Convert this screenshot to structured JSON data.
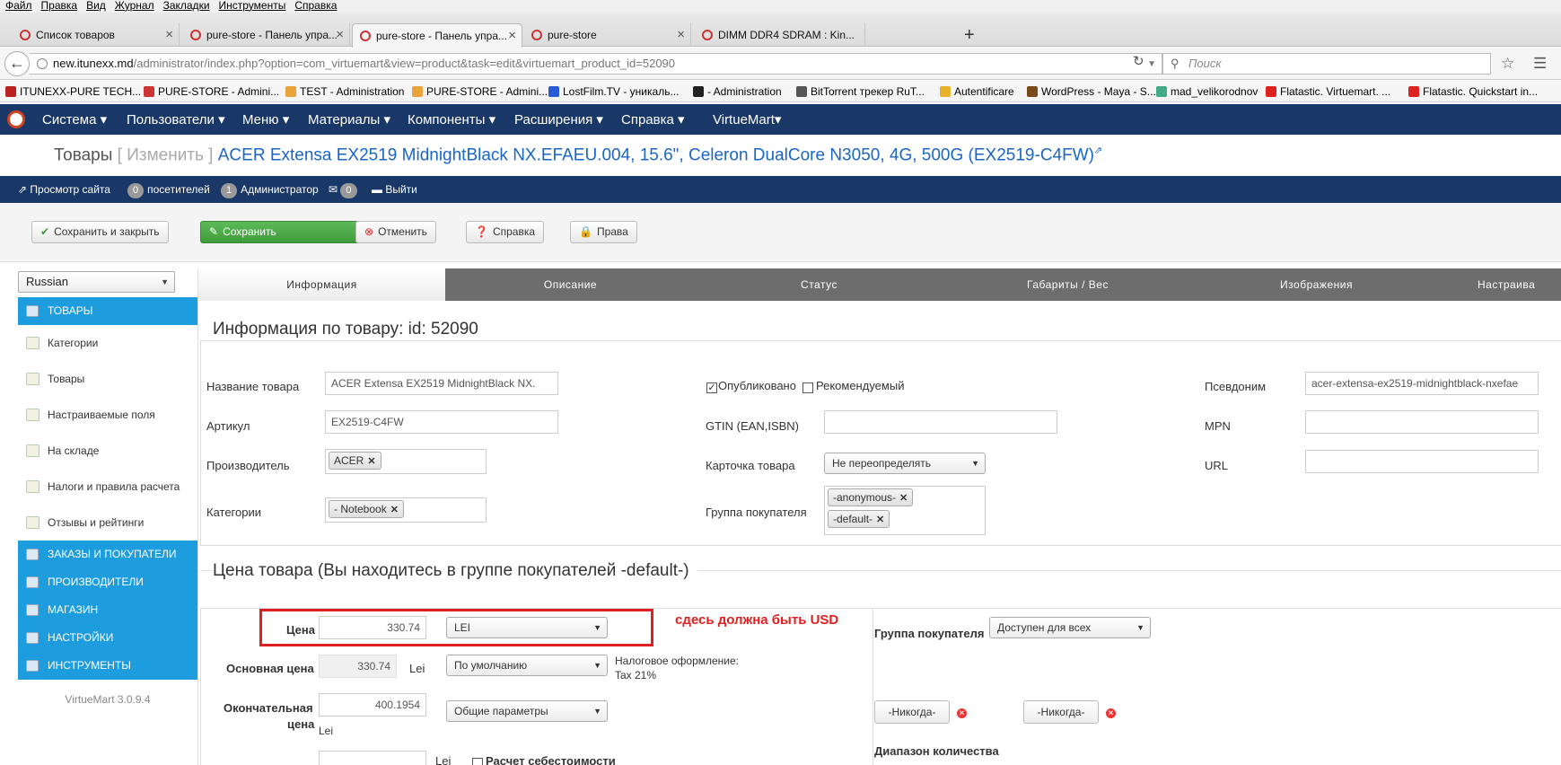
{
  "browser": {
    "menu": [
      "Файл",
      "Правка",
      "Вид",
      "Журнал",
      "Закладки",
      "Инструменты",
      "Справка"
    ],
    "tabs": [
      {
        "label": "Список товаров"
      },
      {
        "label": "pure-store - Панель упра..."
      },
      {
        "label": "pure-store - Панель упра..."
      },
      {
        "label": "pure-store"
      },
      {
        "label": "DIMM DDR4 SDRAM : Kin..."
      }
    ],
    "new_tab": "+",
    "url_host": "new.itunexx.md",
    "url_path": "/administrator/index.php?option=com_virtuemart&view=product&task=edit&virtuemart_product_id=52090",
    "search_placeholder": "Поиск",
    "bookmarks": [
      {
        "label": "ITUNEXX-PURE TECH...",
        "color": "#b22"
      },
      {
        "label": "PURE-STORE - Admini...",
        "color": "#c33"
      },
      {
        "label": "TEST - Administration",
        "color": "#e8a33a"
      },
      {
        "label": "PURE-STORE - Admini...",
        "color": "#e8a33a"
      },
      {
        "label": "LostFilm.TV - уникаль...",
        "color": "#2a5bd7"
      },
      {
        "label": "- Administration",
        "color": "#222"
      },
      {
        "label": "BitTorrent трекер RuT...",
        "color": "#555"
      },
      {
        "label": "Autentificare",
        "color": "#e8b22a"
      },
      {
        "label": "WordPress - Maya - S...",
        "color": "#7a4a1a"
      },
      {
        "label": "mad_velikorodnov",
        "color": "#4a8"
      },
      {
        "label": "Flatastic. Virtuemart. ...",
        "color": "#d22"
      },
      {
        "label": "Flatastic. Quickstart in...",
        "color": "#d22"
      }
    ]
  },
  "admin_menu": [
    "Система ▾",
    "Пользователи ▾",
    "Меню ▾",
    "Материалы ▾",
    "Компоненты ▾",
    "Расширения ▾",
    "Справка ▾",
    "VirtueMart▾"
  ],
  "title": {
    "section": "Товары",
    "mode": "[ Изменить ]",
    "product": "ACER Extensa EX2519 MidnightBlack NX.EFAEU.004, 15.6\", Celeron DualCore N3050, 4G, 500G (EX2519-C4FW)"
  },
  "status": {
    "view_site": "Просмотр сайта",
    "visitors_count": "0",
    "visitors_label": "посетителей",
    "admins_count": "1",
    "admins_label": "Администратор",
    "messages_count": "0",
    "logout": "Выйти"
  },
  "toolbar": {
    "save_close": "Сохранить и закрыть",
    "save": "Сохранить",
    "cancel": "Отменить",
    "help": "Справка",
    "rights": "Права"
  },
  "sidebar": {
    "language": "Russian",
    "header_products": "ТОВАРЫ",
    "items": [
      "Категории",
      "Товары",
      "Настраиваемые поля",
      "На складе",
      "Налоги и правила расчета",
      "Отзывы и рейтинги"
    ],
    "sections": [
      "ЗАКАЗЫ И ПОКУПАТЕЛИ",
      "ПРОИЗВОДИТЕЛИ",
      "МАГАЗИН",
      "НАСТРОЙКИ",
      "ИНСТРУМЕНТЫ"
    ],
    "version": "VirtueMart 3.0.9.4"
  },
  "tabs": [
    "Информация",
    "Описание",
    "Статус",
    "Габариты / Вес",
    "Изображения",
    "Настраива"
  ],
  "info": {
    "heading": "Информация по товару: id: 52090",
    "name_label": "Название товара",
    "name_value": "ACER Extensa EX2519 MidnightBlack NX.",
    "sku_label": "Артикул",
    "sku_value": "EX2519-C4FW",
    "manufacturer_label": "Производитель",
    "manufacturer_value": "ACER",
    "categories_label": "Категории",
    "categories_value": "- Notebook",
    "published_label": "Опубликовано",
    "featured_label": "Рекомендуемый",
    "gtin_label": "GTIN (EAN,ISBN)",
    "gtin_value": "",
    "card_label": "Карточка товара",
    "card_value": "Не переопределять",
    "group_label": "Группа покупателя",
    "groups": [
      "-anonymous-",
      "-default-"
    ],
    "alias_label": "Псевдоним",
    "alias_value": "acer-extensa-ex2519-midnightblack-nxefae",
    "mpn_label": "MPN",
    "mpn_value": "",
    "url_label": "URL",
    "url_value": ""
  },
  "price": {
    "heading": "Цена товара (Вы находитесь в группе покупателей -default-)",
    "price_label": "Цена",
    "price_value": "330.74",
    "currency": "LEI",
    "annotation": "сдесь должна быть USD",
    "annotation_color": "#e02020",
    "base_label": "Основная цена",
    "base_value": "330.74",
    "base_currency": "Lei",
    "base_rule": "По умолчанию",
    "tax_label": "Налоговое оформление:",
    "tax_value": "Tax 21%",
    "final_label_1": "Окончательная",
    "final_label_2": "цена",
    "final_value": "400.1954",
    "final_currency": "Lei",
    "final_rule": "Общие параметры",
    "cost_currency": "Lei",
    "cost_label": "Расчет себестоимости",
    "shopper_group_label": "Группа покупателя",
    "shopper_group_value": "Доступен для всех",
    "never_1": "-Никогда-",
    "never_2": "-Никогда-",
    "qty_range_label": "Диапазон количества"
  }
}
